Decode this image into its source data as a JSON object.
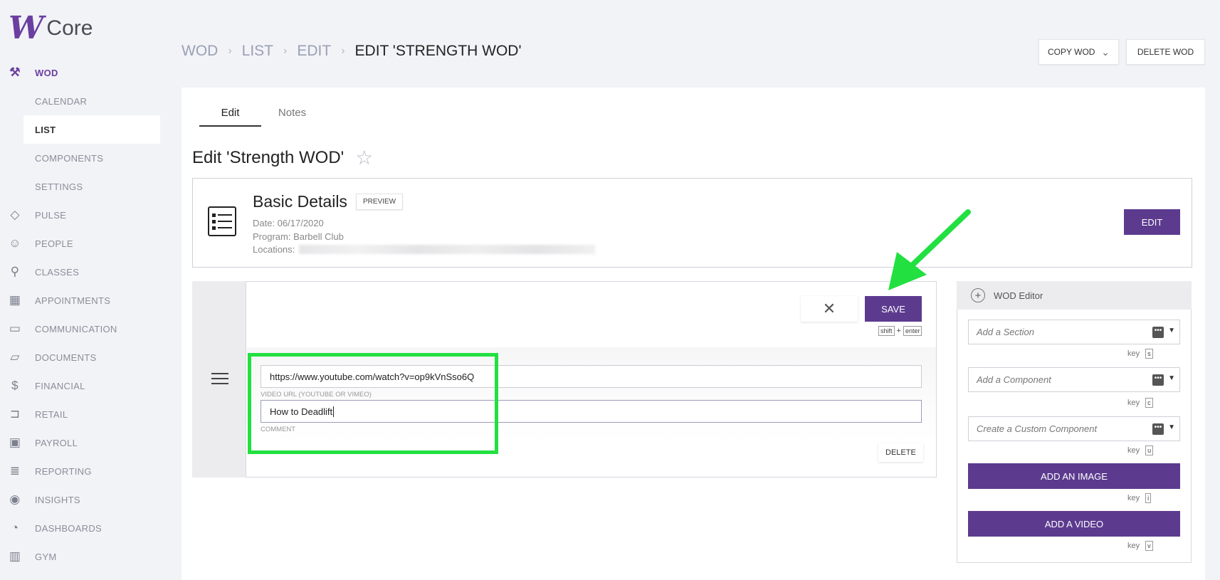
{
  "app": {
    "logo_mark": "W",
    "logo_text": "Core"
  },
  "sidebar": {
    "items": [
      {
        "label": "WOD",
        "icon": "dumbbell-icon"
      },
      {
        "label": "CALENDAR"
      },
      {
        "label": "LIST"
      },
      {
        "label": "COMPONENTS"
      },
      {
        "label": "SETTINGS"
      },
      {
        "label": "PULSE",
        "icon": "pulse-icon"
      },
      {
        "label": "PEOPLE",
        "icon": "people-icon"
      },
      {
        "label": "CLASSES",
        "icon": "classes-icon"
      },
      {
        "label": "APPOINTMENTS",
        "icon": "calendar-icon"
      },
      {
        "label": "COMMUNICATION",
        "icon": "chat-icon"
      },
      {
        "label": "DOCUMENTS",
        "icon": "folder-icon"
      },
      {
        "label": "FINANCIAL",
        "icon": "dollar-icon"
      },
      {
        "label": "RETAIL",
        "icon": "cart-icon"
      },
      {
        "label": "PAYROLL",
        "icon": "payroll-icon"
      },
      {
        "label": "REPORTING",
        "icon": "report-icon"
      },
      {
        "label": "INSIGHTS",
        "icon": "eye-icon"
      },
      {
        "label": "DASHBOARDS",
        "icon": "gauge-icon"
      },
      {
        "label": "GYM",
        "icon": "building-icon"
      }
    ]
  },
  "breadcrumb": {
    "items": [
      "WOD",
      "LIST",
      "EDIT"
    ],
    "current": "EDIT 'STRENGTH WOD'"
  },
  "toolbar": {
    "copy_label": "COPY WOD",
    "delete_label": "DELETE WOD"
  },
  "tabs": [
    {
      "label": "Edit"
    },
    {
      "label": "Notes"
    }
  ],
  "page_title": "Edit 'Strength WOD'",
  "details": {
    "title": "Basic Details",
    "preview_label": "PREVIEW",
    "date": "Date: 06/17/2020",
    "program": "Program: Barbell Club",
    "locations_label": "Locations:",
    "edit_label": "EDIT"
  },
  "component": {
    "save_label": "SAVE",
    "shortcut": {
      "key1": "shift",
      "plus": "+",
      "key2": "enter"
    },
    "video_url": "https://www.youtube.com/watch?v=op9kVnSso6Q",
    "video_url_label": "VIDEO URL (YOUTUBE OR VIMEO)",
    "comment": "How to Deadlift",
    "comment_label": "COMMENT",
    "delete_label": "DELETE"
  },
  "wod_editor": {
    "title": "WOD Editor",
    "add_section_placeholder": "Add a Section",
    "add_component_placeholder": "Add a Component",
    "custom_component_placeholder": "Create a Custom Component",
    "key_label": "key",
    "keys": [
      "s",
      "c",
      "u",
      "i",
      "v"
    ],
    "add_image_label": "ADD AN IMAGE",
    "add_video_label": "ADD A VIDEO"
  },
  "colors": {
    "brand": "#5c3b8f",
    "annotation": "#22e040"
  }
}
